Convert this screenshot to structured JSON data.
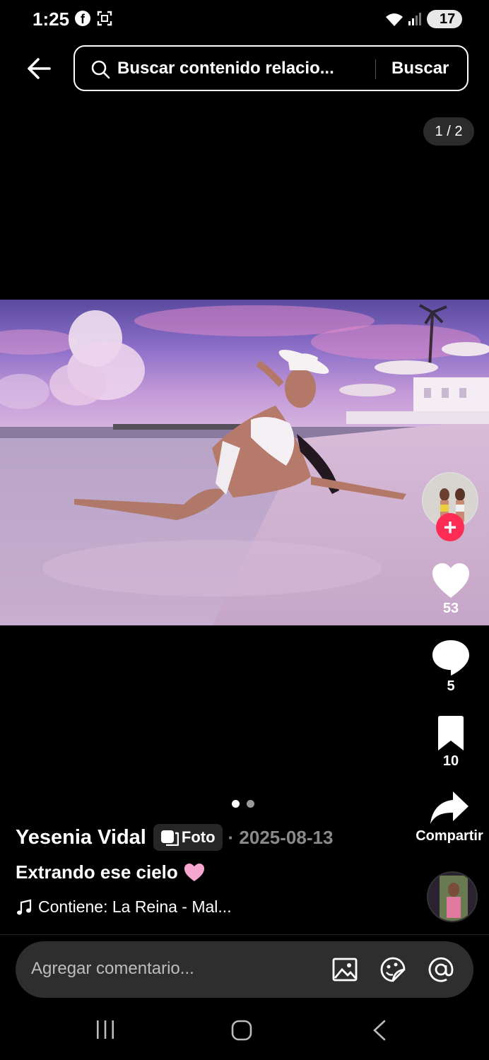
{
  "status_bar": {
    "time": "1:25",
    "battery": "17"
  },
  "header": {
    "search_text": "Buscar contenido relacio...",
    "search_button": "Buscar",
    "page_counter": "1 / 2"
  },
  "actions": {
    "likes": "53",
    "comments": "5",
    "saves": "10",
    "share_label": "Compartir"
  },
  "post": {
    "author": "Yesenia Vidal",
    "tag": "Foto",
    "date": "· 2025-08-13",
    "caption": "Extrando ese cielo",
    "music": "Contiene: La Reina - Mal..."
  },
  "carousel": {
    "total": 2,
    "current": 1
  },
  "comment_bar": {
    "placeholder": "Agregar comentario..."
  },
  "colors": {
    "accent": "#fe2c55",
    "background": "#000000"
  },
  "icons": [
    "back-arrow-icon",
    "search-icon",
    "heart-icon",
    "comment-icon",
    "bookmark-icon",
    "share-icon",
    "music-note-icon",
    "image-icon",
    "sticker-icon",
    "mention-icon",
    "photo-tag-icon"
  ]
}
